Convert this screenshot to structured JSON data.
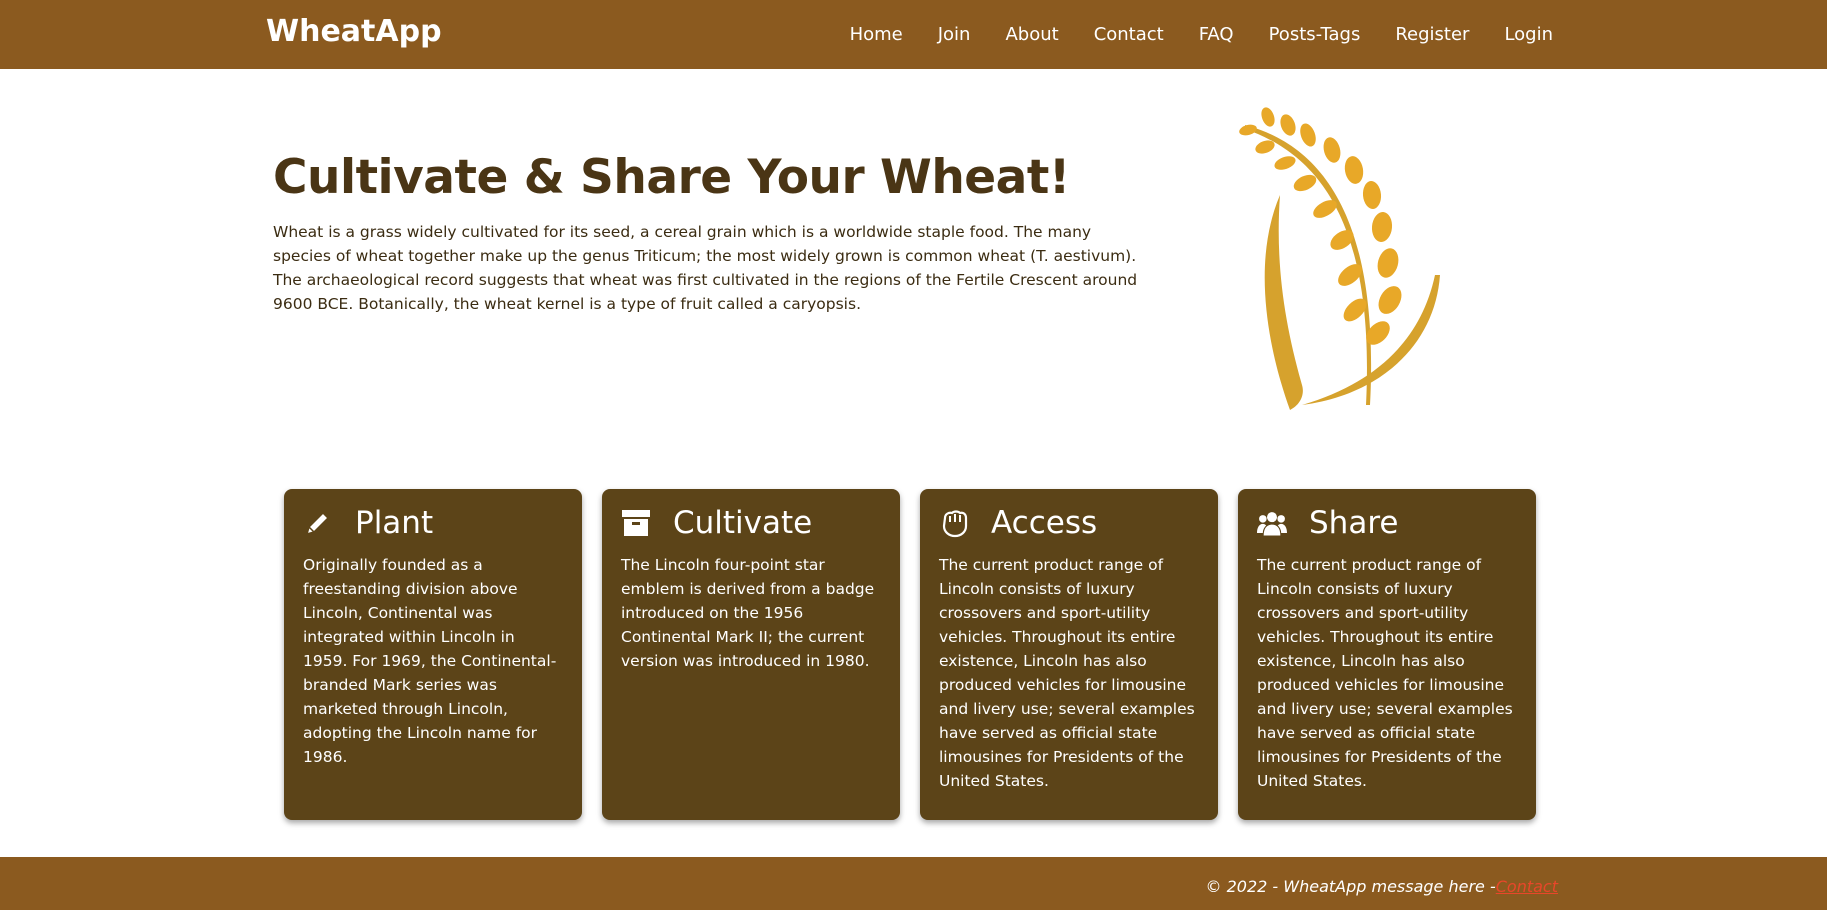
{
  "navbar": {
    "brand": "WheatApp",
    "links": [
      "Home",
      "Join",
      "About",
      "Contact",
      "FAQ",
      "Posts-Tags",
      "Register",
      "Login"
    ]
  },
  "hero": {
    "title": "Cultivate & Share Your Wheat!",
    "text": "Wheat is a grass widely cultivated for its seed, a cereal grain which is a worldwide staple food. The many species of wheat together make up the genus Triticum; the most widely grown is common wheat (T. aestivum). The archaeological record suggests that wheat was first cultivated in the regions of the Fertile Crescent around 9600 BCE. Botanically, the wheat kernel is a type of fruit called a caryopsis."
  },
  "cards": [
    {
      "icon": "pencil-icon",
      "title": "Plant",
      "text": "Originally founded as a freestanding division above Lincoln, Continental was integrated within Lincoln in 1959. For 1969, the Continental-branded Mark series was marketed through Lincoln, adopting the Lincoln name for 1986."
    },
    {
      "icon": "archive-box-icon",
      "title": "Cultivate",
      "text": "The Lincoln four-point star emblem is derived from a badge introduced on the 1956 Continental Mark II; the current version was introduced in 1980."
    },
    {
      "icon": "hand-icon",
      "title": "Access",
      "text": "The current product range of Lincoln consists of luxury crossovers and sport-utility vehicles. Throughout its entire existence, Lincoln has also produced vehicles for limousine and livery use; several examples have served as official state limousines for Presidents of the United States."
    },
    {
      "icon": "users-icon",
      "title": "Share",
      "text": "The current product range of Lincoln consists of luxury crossovers and sport-utility vehicles. Throughout its entire existence, Lincoln has also produced vehicles for limousine and livery use; several examples have served as official state limousines for Presidents of the United States."
    }
  ],
  "footer": {
    "text": "© 2022 - WheatApp message here -",
    "link": "Contact"
  },
  "colors": {
    "navbar": "#8b5a1f",
    "card": "#5c4418",
    "wheat": "#e8a828",
    "footer_link": "#e8472a"
  }
}
